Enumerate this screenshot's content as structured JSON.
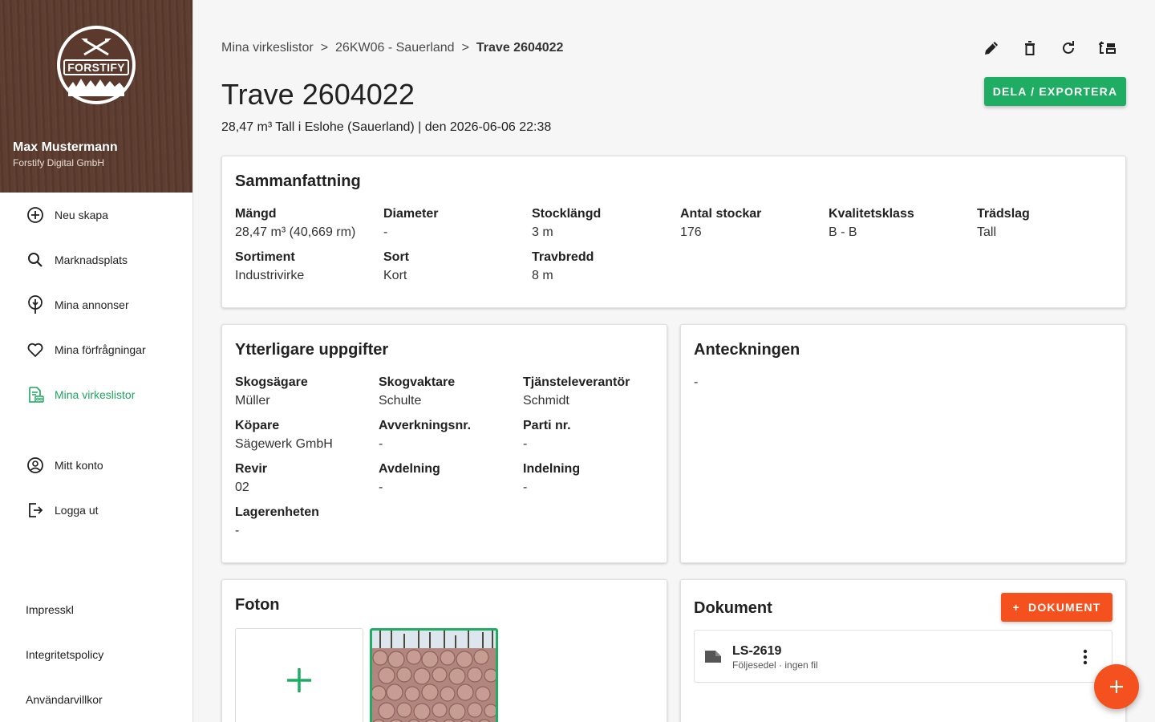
{
  "brand": {
    "logo_text": "FORSTIFY"
  },
  "user": {
    "name": "Max Mustermann",
    "company": "Forstify Digital GmbH"
  },
  "nav": {
    "items": [
      {
        "label": "Neu skapa",
        "icon": "add-circle-icon"
      },
      {
        "label": "Marknadsplats",
        "icon": "search-icon"
      },
      {
        "label": "Mina annonser",
        "icon": "tree-pin-icon"
      },
      {
        "label": "Mina förfrågningar",
        "icon": "heart-icon"
      },
      {
        "label": "Mina virkeslistor",
        "icon": "log-list-icon",
        "active": true
      },
      {
        "label": "Mitt konto",
        "icon": "account-icon"
      },
      {
        "label": "Logga ut",
        "icon": "logout-icon"
      }
    ],
    "footer": [
      "Impresskl",
      "Integritetspolicy",
      "Användarvillkor"
    ]
  },
  "breadcrumb": [
    "Mina virkeslistor",
    "26KW06 - Sauerland",
    "Trave 2604022"
  ],
  "breadcrumb_separator": ">",
  "toolbar": {
    "icons": [
      "edit-icon",
      "delete-icon",
      "refresh-icon",
      "transfer-icon"
    ]
  },
  "header": {
    "title": "Trave 2604022",
    "subtitle": "28,47 m³ Tall i Eslohe (Sauerland) | den 2026-06-06 22:38",
    "export_label": "DELA / EXPORTERA"
  },
  "summary": {
    "title": "Sammanfattning",
    "fields": [
      {
        "label": "Mängd",
        "value": "28,47 m³ (40,669 rm)"
      },
      {
        "label": "Diameter",
        "value": "-"
      },
      {
        "label": "Stocklängd",
        "value": "3 m"
      },
      {
        "label": "Antal stockar",
        "value": "176"
      },
      {
        "label": "Kvalitetsklass",
        "value": "B - B"
      },
      {
        "label": "Trädslag",
        "value": "Tall"
      },
      {
        "label": "Sortiment",
        "value": "Industrivirke"
      },
      {
        "label": "Sort",
        "value": "Kort"
      },
      {
        "label": "Travbredd",
        "value": "8 m"
      }
    ]
  },
  "details": {
    "title": "Ytterligare uppgifter",
    "fields": [
      {
        "label": "Skogsägare",
        "value": "Müller"
      },
      {
        "label": "Skogvaktare",
        "value": "Schulte"
      },
      {
        "label": "Tjänsteleverantör",
        "value": "Schmidt"
      },
      {
        "label": "Köpare",
        "value": "Sägewerk GmbH"
      },
      {
        "label": "Avverkningsnr.",
        "value": "-"
      },
      {
        "label": "Parti nr.",
        "value": "-"
      },
      {
        "label": "Revir",
        "value": "02"
      },
      {
        "label": "Avdelning",
        "value": "-"
      },
      {
        "label": "Indelning",
        "value": "-"
      },
      {
        "label": "Lagerenheten",
        "value": "-"
      }
    ]
  },
  "notes": {
    "title": "Anteckningen",
    "value": "-"
  },
  "photos": {
    "title": "Foton"
  },
  "documents": {
    "title": "Dokument",
    "add_label": "DOKUMENT",
    "items": [
      {
        "name": "LS-2619",
        "meta": "Följesedel · ingen fil"
      }
    ]
  },
  "colors": {
    "accent": "#1fad63",
    "action": "#f4511e",
    "sidebar_header": "#5b3a2d"
  }
}
